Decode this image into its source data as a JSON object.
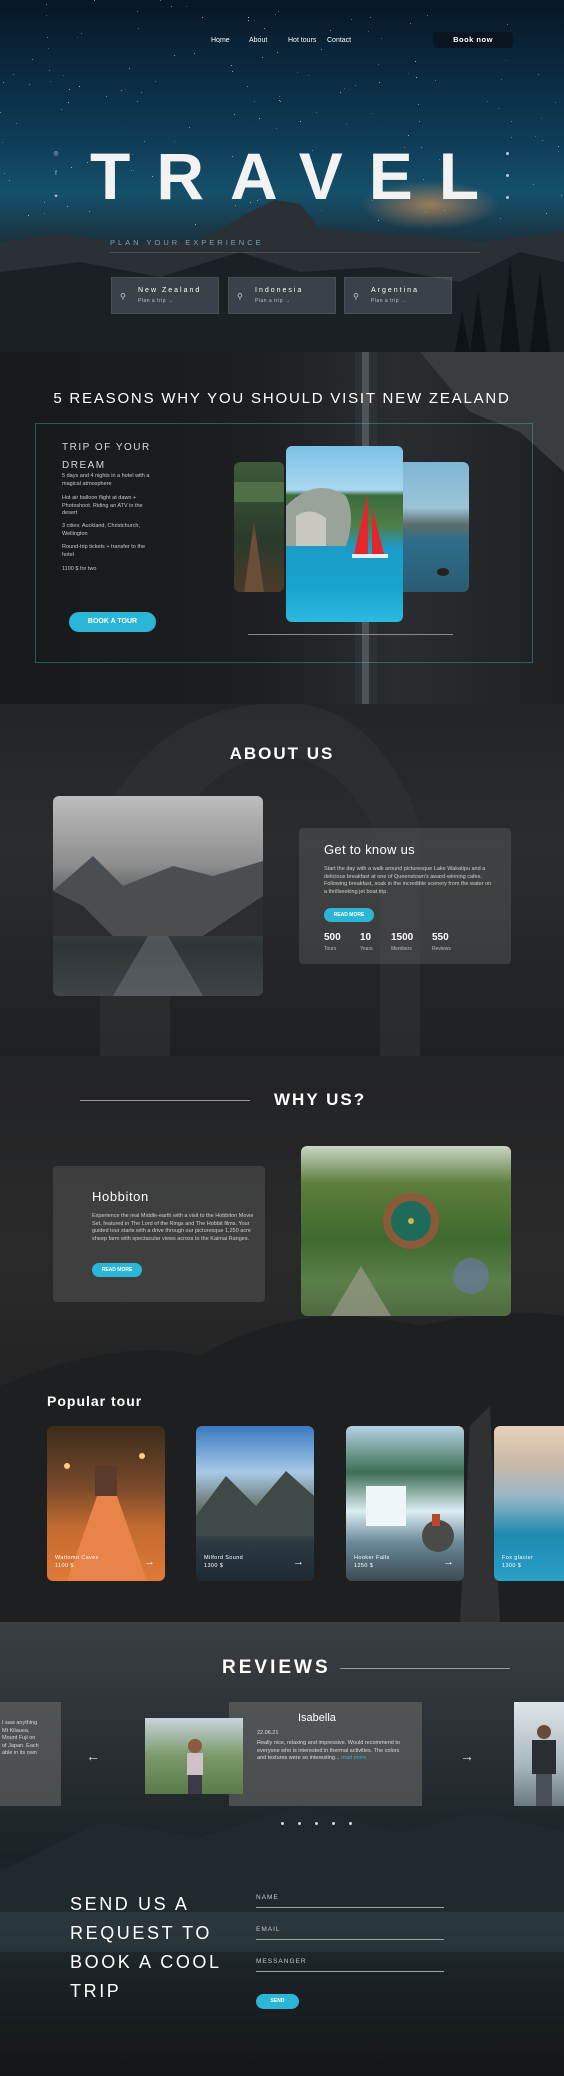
{
  "nav": {
    "links": [
      "Home",
      "About",
      "Hot tours",
      "Contact"
    ],
    "book_label": "Book now"
  },
  "hero": {
    "title": "TRAVEL",
    "subtitle": "PLAN YOUR EXPERIENCE",
    "destinations": [
      {
        "name": "New Zealand",
        "sub": "Plan a trip →"
      },
      {
        "name": "Indonesia",
        "sub": "Plan a trip →"
      },
      {
        "name": "Argentina",
        "sub": "Plan a trip →"
      }
    ],
    "social_icons": [
      "instagram-icon",
      "facebook-icon",
      "twitter-icon"
    ]
  },
  "reasons": {
    "title": "5 REASONS WHY YOU SHOULD VISIT NEW ZEALAND",
    "trip_heading": "TRIP OF YOUR DREAM",
    "items": [
      "5 days and 4 nights in a hotel with a magical atmosphere",
      "Hot air balloon flight at dawn + Photoshoot. Riding an ATV in the desert",
      "3 cities: Auckland, Christchurch, Wellington",
      "Round-trip tickets + transfer to the hotel",
      "1100 $ for two"
    ],
    "button": "BOOK A TOUR"
  },
  "about": {
    "title": "ABOUT US",
    "card_title": "Get to know us",
    "card_text": "Start the day with a walk around picturesque Lake Wakatipu and a delicious breakfast at one of Queenstown's award-winning cafes. Following breakfast, soak in the incredible scenery from the water on a thrillseeking jet boat trip.",
    "button": "READ MORE",
    "stats": [
      {
        "n": "500",
        "l": "Tours"
      },
      {
        "n": "10",
        "l": "Years"
      },
      {
        "n": "1500",
        "l": "Members"
      },
      {
        "n": "550",
        "l": "Reviews"
      }
    ]
  },
  "why": {
    "title": "WHY US?",
    "card_title": "Hobbiton",
    "card_text": "Experience the real Middle-earth with a visit to the Hobbiton Movie Set, featured in The Lord of the Rings and The Hobbit films. Your guided tour starts with a drive through our picturesque 1,250 acre sheep farm with spectacular views across to the Kaimai Ranges.",
    "button": "READ MORE"
  },
  "popular": {
    "title": "Popular tour",
    "tours": [
      {
        "name": "Waitomo Caves",
        "price": "1100 $"
      },
      {
        "name": "Milford Sound",
        "price": "1300 $"
      },
      {
        "name": "Hooker Falls",
        "price": "1250 $"
      },
      {
        "name": "Fox glacier",
        "price": "1300 $"
      }
    ]
  },
  "reviews": {
    "title": "REVIEWS",
    "left_text": "I saw anything … Mt Kilauea, … Mount Fuji on … of Japan. Each … able in its own",
    "left_lines": [
      "I saw anything",
      "Mt Kilauea,",
      "Mount Fuji on",
      "of Japan. Each",
      "able in its own"
    ],
    "name": "Isabella",
    "date": "22.06.21",
    "text": "Really nice, relaxing and impressive. Would recommend to everyone who is interested in thermal activities. The colors and textures were so interesting...",
    "more": "read more"
  },
  "request": {
    "title": "SEND US A REQUEST TO BOOK A COOL TRIP",
    "fields": [
      "NAME",
      "EMAIL",
      "MESSANGER"
    ],
    "button": "SEND"
  }
}
